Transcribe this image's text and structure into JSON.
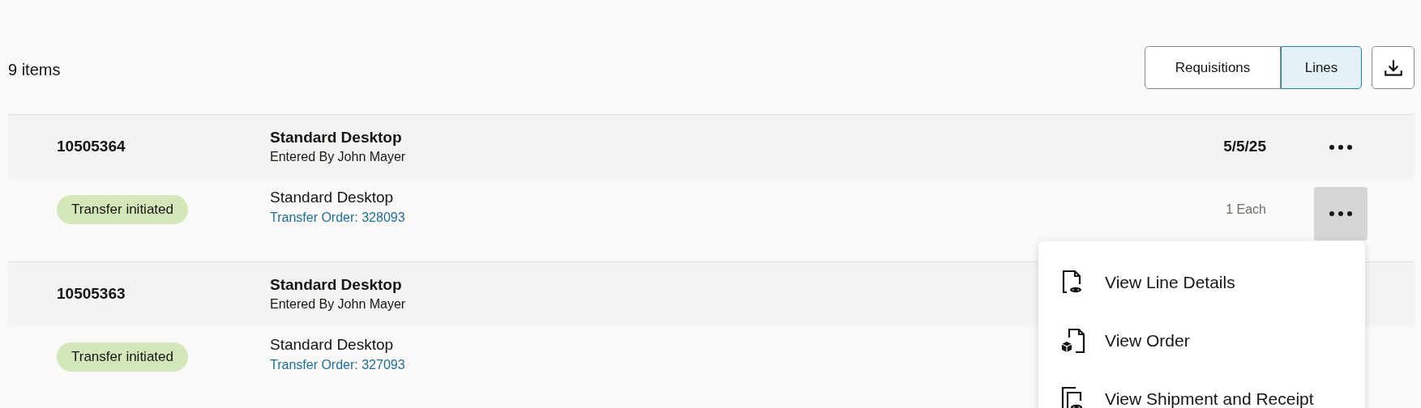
{
  "toolbar": {
    "count": "9 items",
    "views": [
      {
        "label": "Requisitions",
        "selected": false
      },
      {
        "label": "Lines",
        "selected": true
      }
    ]
  },
  "rows": [
    {
      "number": "10505364",
      "title": "Standard Desktop",
      "entered_by": "Entered By John Mayer",
      "date": "5/5/25",
      "header_menu": {
        "active": false
      },
      "status": "Transfer initiated",
      "item": "Standard Desktop",
      "link": "Transfer Order: 328093",
      "quantity": "1 Each",
      "line_menu": {
        "active": true
      }
    },
    {
      "number": "10505363",
      "title": "Standard Desktop",
      "entered_by": "Entered By John Mayer",
      "status": "Transfer initiated",
      "item": "Standard Desktop",
      "link": "Transfer Order: 327093"
    }
  ],
  "menu": {
    "items": [
      {
        "kind": "details",
        "label": "View Line Details"
      },
      {
        "kind": "order",
        "label": "View Order"
      },
      {
        "kind": "shipment",
        "label": "View Shipment and Receipt"
      }
    ]
  }
}
